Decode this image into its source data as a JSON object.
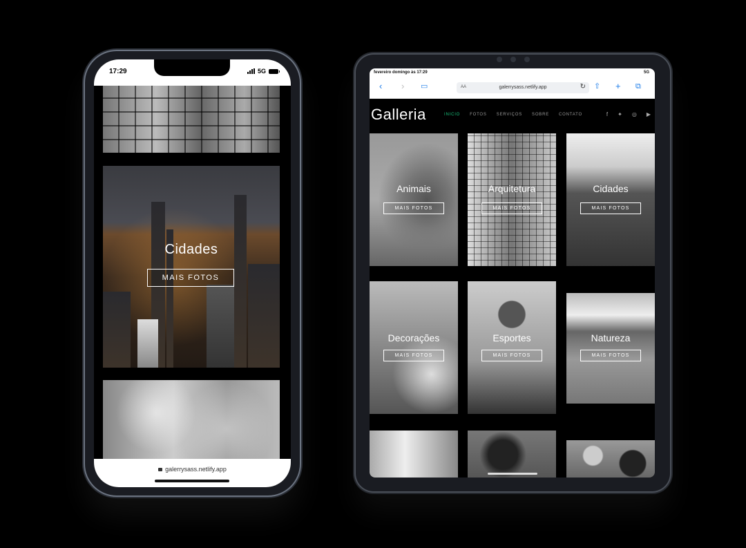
{
  "phone": {
    "status": {
      "time": "17:29",
      "network": "5G"
    },
    "panels": [
      {
        "caption": "Cidades",
        "button": "MAIS FOTOS"
      }
    ],
    "url": "galerrysass.netlify.app"
  },
  "tablet": {
    "status": {
      "date": "fevereiro domingo às 17:29",
      "network": "5G"
    },
    "browser": {
      "aa": "AA",
      "url": "galerrysass.netlify.app"
    },
    "site": {
      "logo": "Galleria",
      "nav": [
        {
          "label": "INICIO",
          "active": true
        },
        {
          "label": "FOTOS",
          "active": false
        },
        {
          "label": "SERVIÇOS",
          "active": false
        },
        {
          "label": "SOBRE",
          "active": false
        },
        {
          "label": "CONTATO",
          "active": false
        }
      ],
      "social": [
        "facebook-icon",
        "twitter-icon",
        "instagram-icon",
        "youtube-icon"
      ],
      "accent": "#19c37d"
    },
    "cards": [
      {
        "caption": "Animais",
        "button": "MAIS FOTOS"
      },
      {
        "caption": "Arquitetura",
        "button": "MAIS FOTOS"
      },
      {
        "caption": "Cidades",
        "button": "MAIS FOTOS"
      },
      {
        "caption": "Decorações",
        "button": "MAIS FOTOS"
      },
      {
        "caption": "Esportes",
        "button": "MAIS FOTOS"
      },
      {
        "caption": "Natureza",
        "button": "MAIS FOTOS"
      }
    ]
  }
}
